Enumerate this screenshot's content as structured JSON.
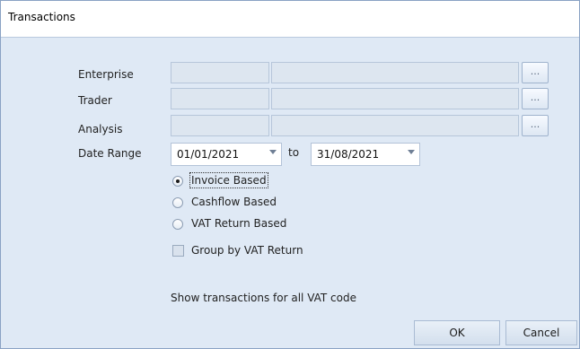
{
  "window": {
    "title": "Transactions"
  },
  "form": {
    "enterprise_label": "Enterprise",
    "trader_label": "Trader",
    "analysis_label": "Analysis",
    "date_range_label": "Date Range",
    "ellipsis": "...",
    "date_from": "01/01/2021",
    "to_label": "to",
    "date_to": "31/08/2021",
    "basis_options": [
      "Invoice Based",
      "Cashflow Based",
      "VAT Return Based"
    ],
    "selected_basis": "Invoice Based",
    "group_by_label": "Group by VAT Return",
    "group_by_checked": false,
    "info_text": "Show transactions for all VAT code"
  },
  "buttons": {
    "ok": "OK",
    "cancel": "Cancel"
  }
}
